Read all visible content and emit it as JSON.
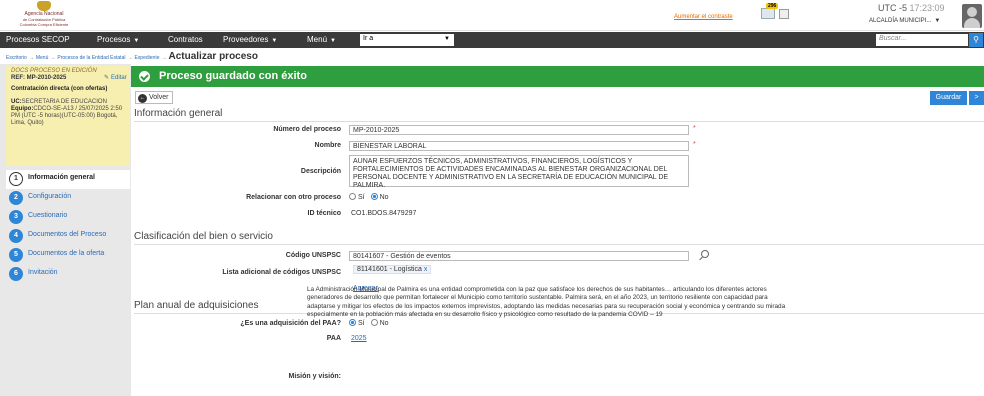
{
  "header": {
    "logo_line1": "Agencia Nacional",
    "logo_line2": "de Contratación Pública",
    "logo_line3": "Colombia Compra Eficiente",
    "aumentar_link": "Aumentar el contraste",
    "notification_count": "296",
    "timezone": "UTC -5",
    "time": "17:23:09",
    "user_name": "ALCALDÍA MUNICIPI..."
  },
  "nav": {
    "items": [
      "Procesos SECOP",
      "Procesos",
      "Contratos",
      "Proveedores",
      "Menú"
    ],
    "ira_value": "Ir a",
    "search_placeholder": "Buscar..."
  },
  "breadcrumb": {
    "items": [
      "Escritorio",
      "Menú",
      "Procesos de la Entidad Estatal",
      "Expediente"
    ],
    "current": "Actualizar proceso"
  },
  "sidebar": {
    "status": "DOCS PROCESO EN EDICIÓN",
    "ref": "REF: MP-2010-2025",
    "editar": "Editar",
    "tipo": "Contratación directa (con ofertas)",
    "uc_label": "UC:",
    "uc_value": "SECRETARIA DE EDUCACION",
    "equipo_label": "Equipo:",
    "equipo_value": "CDCO-SE-A13 / 25/07/2025 2:50 PM (UTC -5 horas)(UTC-05:00) Bogotá, Lima, Quito)",
    "steps": [
      {
        "num": "1",
        "label": "Información general"
      },
      {
        "num": "2",
        "label": "Configuración"
      },
      {
        "num": "3",
        "label": "Cuestionario"
      },
      {
        "num": "4",
        "label": "Documentos del Proceso"
      },
      {
        "num": "5",
        "label": "Documentos de la oferta"
      },
      {
        "num": "6",
        "label": "Invitación"
      }
    ]
  },
  "main": {
    "success_message": "Proceso guardado con éxito",
    "volver": "Volver",
    "guardar": "Guardar",
    "next": ">",
    "sections": {
      "general": "Información general",
      "clasificacion": "Clasificación del bien o servicio",
      "plan": "Plan anual de adquisiciones"
    },
    "labels": {
      "numero": "Número del proceso",
      "nombre": "Nombre",
      "descripcion": "Descripción",
      "relacionar": "Relacionar con otro proceso",
      "id_tecnico": "ID técnico",
      "codigo": "Código UNSPSC",
      "lista": "Lista adicional de códigos UNSPSC",
      "paa_q": "¿Es una adquisición del PAA?",
      "paa": "PAA",
      "mision": "Misión y visión:"
    },
    "values": {
      "numero": "MP-2010-2025",
      "nombre": "BIENESTAR LABORAL",
      "descripcion": "AUNAR ESFUERZOS TÉCNICOS, ADMINISTRATIVOS, FINANCIEROS, LOGÍSTICOS Y FORTALECIMIENTOS DE ACTIVIDADES ENCAMINADAS AL BIENESTAR ORGANIZACIONAL DEL PERSONAL DOCENTE Y ADMINISTRATIVO EN LA SECRETARÍA DE EDUCACIÓN MUNICIPAL DE PALMIRA.",
      "si": "Sí",
      "no": "No",
      "id_tecnico": "CO1.BDOS.8479297",
      "codigo": "80141607 - Gestión de eventos",
      "lista_tag": "81141601 - Logística",
      "agregar": "Agregar",
      "paa_link": "2025",
      "mision": "La Administración Municipal de Palmira es una entidad comprometida con la paz que satisface los derechos de sus habitantes… articulando los diferentes actores generadores de desarrollo que permitan fortalecer el Municipio como territorio sustentable. Palmira será, en el año 2023, un territorio resiliente con capacidad para adaptarse y mitigar los efectos de los impactos externos imprevistos, adoptando las medidas necesarias para su recuperación social y económica y centrando su mirada especialmente en la población más afectada en su desarrollo físico y psicológico como resultado de la pandemia COVID – 19"
    }
  },
  "colors": {
    "success": "#2e9e3e",
    "primary": "#2f86d6",
    "navbar": "#3a3a3a",
    "sidebar_box": "#f7efb0"
  },
  "icons": [
    "checkmark-icon",
    "back-arrow-icon",
    "search-icon",
    "calendar-icon",
    "avatar-icon",
    "edit-icon",
    "lookup-icon"
  ]
}
